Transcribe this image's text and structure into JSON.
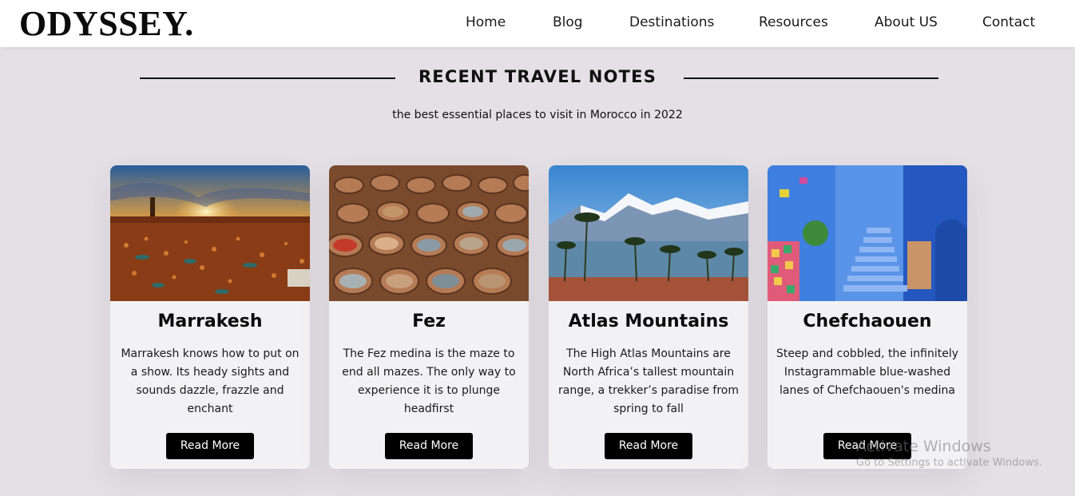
{
  "header": {
    "logo": "ODYSSEY.",
    "nav": [
      "Home",
      "Blog",
      "Destinations",
      "Resources",
      "About US",
      "Contact"
    ]
  },
  "section": {
    "title": "RECENT TRAVEL NOTES",
    "subtitle": "the best essential places to visit in Morocco in 2022"
  },
  "cards": [
    {
      "title": "Marrakesh",
      "text": "Marrakesh knows how to put on a show. Its heady sights and sounds dazzle, frazzle and enchant",
      "button": "Read More",
      "image": "marrakesh-square-sunset"
    },
    {
      "title": "Fez",
      "text": "The Fez medina is the maze to end all mazes. The only way to experience it is to plunge headfirst",
      "button": "Read More",
      "image": "fez-tannery-vats"
    },
    {
      "title": "Atlas Mountains",
      "text": "The High Atlas Mountains are North Africa’s tallest mountain range, a trekker’s paradise from spring to fall",
      "button": "Read More",
      "image": "atlas-snowy-peaks-palms"
    },
    {
      "title": "Chefchaouen",
      "text": "Steep and cobbled, the infinitely Instagrammable blue-washed lanes of Chefchaouen's medina",
      "button": "Read More",
      "image": "chefchaouen-blue-stairs"
    }
  ],
  "watermark": {
    "line1": "Activate Windows",
    "line2": "Go to Settings to activate Windows."
  },
  "colors": {
    "page_background": "#e4e0e5",
    "header_background": "#ffffff",
    "card_background": "#f2f2f4",
    "button_background": "#000000",
    "button_text": "#ffffff"
  }
}
